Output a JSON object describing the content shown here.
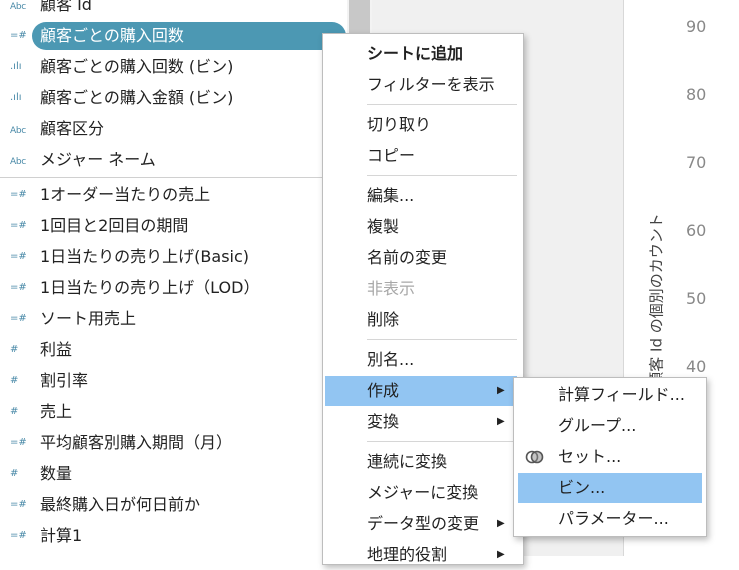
{
  "fields": [
    {
      "icon": "Abc",
      "label": "顧客 Id"
    },
    {
      "icon": "=#",
      "label": "顧客ごとの購入回数",
      "selected": true
    },
    {
      "icon": ".ılı",
      "label": "顧客ごとの購入回数 (ビン)"
    },
    {
      "icon": ".ılı",
      "label": "顧客ごとの購入金額 (ビン)"
    },
    {
      "icon": "Abc",
      "label": "顧客区分"
    },
    {
      "icon": "Abc",
      "label": "メジャー ネーム"
    },
    {
      "icon": "=#",
      "label": "1オーダー当たりの売上"
    },
    {
      "icon": "=#",
      "label": "1回目と2回目の期間"
    },
    {
      "icon": "=#",
      "label": "1日当たりの売り上げ(Basic)"
    },
    {
      "icon": "=#",
      "label": "1日当たりの売り上げ（LOD）"
    },
    {
      "icon": "=#",
      "label": "ソート用売上"
    },
    {
      "icon": "#",
      "label": "利益"
    },
    {
      "icon": "#",
      "label": "割引率"
    },
    {
      "icon": "#",
      "label": "売上"
    },
    {
      "icon": "=#",
      "label": "平均顧客別購入期間（月）"
    },
    {
      "icon": "#",
      "label": "数量"
    },
    {
      "icon": "=#",
      "label": "最終購入日が何日前か"
    },
    {
      "icon": "=#",
      "label": "計算1"
    }
  ],
  "context_menu": {
    "items": [
      {
        "label": "シートに追加",
        "bold": true
      },
      {
        "label": "フィルターを表示"
      },
      {
        "label": "切り取り"
      },
      {
        "label": "コピー"
      },
      {
        "label": "編集..."
      },
      {
        "label": "複製"
      },
      {
        "label": "名前の変更"
      },
      {
        "label": "非表示",
        "disabled": true
      },
      {
        "label": "削除"
      },
      {
        "label": "別名..."
      },
      {
        "label": "作成",
        "submenu": true,
        "highlighted": true
      },
      {
        "label": "変換",
        "submenu": true
      },
      {
        "label": "連続に変換"
      },
      {
        "label": "メジャーに変換"
      },
      {
        "label": "データ型の変更",
        "submenu": true
      },
      {
        "label": "地理的役割",
        "submenu": true
      }
    ]
  },
  "submenu": {
    "items": [
      {
        "label": "計算フィールド..."
      },
      {
        "label": "グループ..."
      },
      {
        "label": "セット...",
        "icon": "set-icon"
      },
      {
        "label": "ビン...",
        "highlighted": true
      },
      {
        "label": "パラメーター..."
      }
    ]
  },
  "axis": {
    "title": "顧客 Id の個別のカウント",
    "ticks": [
      "90",
      "80",
      "70",
      "60",
      "50",
      "40"
    ]
  },
  "colors": {
    "selected_pill": "#4c98b3",
    "menu_highlight": "#92c5f2",
    "icon": "#4a8aa8"
  }
}
